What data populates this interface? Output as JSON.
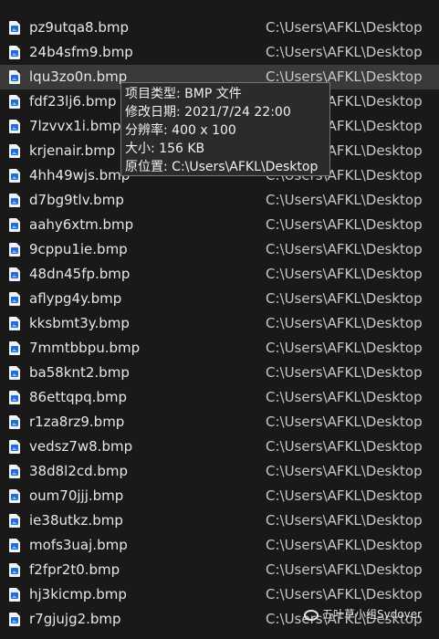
{
  "files": [
    {
      "name": "pz9utqa8.bmp",
      "location": "C:\\Users\\AFKL\\Desktop"
    },
    {
      "name": "24b4sfm9.bmp",
      "location": "C:\\Users\\AFKL\\Desktop"
    },
    {
      "name": "lqu3zo0n.bmp",
      "location": "C:\\Users\\AFKL\\Desktop",
      "selected": true
    },
    {
      "name": "fdf23lj6.bmp",
      "location": "C:\\Users\\AFKL\\Desktop"
    },
    {
      "name": "7lzvvx1i.bmp",
      "location": "C:\\Users\\AFKL\\Desktop"
    },
    {
      "name": "krjenair.bmp",
      "location": "C:\\Users\\AFKL\\Desktop"
    },
    {
      "name": "4hh49wjs.bmp",
      "location": "C:\\Users\\AFKL\\Desktop"
    },
    {
      "name": "d7bg9tlv.bmp",
      "location": "C:\\Users\\AFKL\\Desktop"
    },
    {
      "name": "aahy6xtm.bmp",
      "location": "C:\\Users\\AFKL\\Desktop"
    },
    {
      "name": "9cppu1ie.bmp",
      "location": "C:\\Users\\AFKL\\Desktop"
    },
    {
      "name": "48dn45fp.bmp",
      "location": "C:\\Users\\AFKL\\Desktop"
    },
    {
      "name": "aflypg4y.bmp",
      "location": "C:\\Users\\AFKL\\Desktop"
    },
    {
      "name": "kksbmt3y.bmp",
      "location": "C:\\Users\\AFKL\\Desktop"
    },
    {
      "name": "7mmtbbpu.bmp",
      "location": "C:\\Users\\AFKL\\Desktop"
    },
    {
      "name": "ba58knt2.bmp",
      "location": "C:\\Users\\AFKL\\Desktop"
    },
    {
      "name": "86ettqpq.bmp",
      "location": "C:\\Users\\AFKL\\Desktop"
    },
    {
      "name": "r1za8rz9.bmp",
      "location": "C:\\Users\\AFKL\\Desktop"
    },
    {
      "name": "vedsz7w8.bmp",
      "location": "C:\\Users\\AFKL\\Desktop"
    },
    {
      "name": "38d8l2cd.bmp",
      "location": "C:\\Users\\AFKL\\Desktop"
    },
    {
      "name": "oum70jjj.bmp",
      "location": "C:\\Users\\AFKL\\Desktop"
    },
    {
      "name": "ie38utkz.bmp",
      "location": "C:\\Users\\AFKL\\Desktop"
    },
    {
      "name": "mofs3uaj.bmp",
      "location": "C:\\Users\\AFKL\\Desktop"
    },
    {
      "name": "f2fpr2t0.bmp",
      "location": "C:\\Users\\AFKL\\Desktop"
    },
    {
      "name": "hj3kicmp.bmp",
      "location": "C:\\Users\\AFKL\\Desktop"
    },
    {
      "name": "r7gjujg2.bmp",
      "location": "C:\\Users\\AFKL\\Desktop"
    }
  ],
  "file_icon": "bmp-image-file-icon",
  "tooltip": {
    "type": "项目类型: BMP 文件",
    "modified": "修改日期: 2021/7/24 22:00",
    "resolution": "分辨率: 400 x 100",
    "size": "大小: 156 KB",
    "location": "原位置: C:\\Users\\AFKL\\Desktop"
  },
  "watermark": {
    "text": "五叶草小组Sydoyer",
    "icon": "wechat-icon"
  },
  "colors": {
    "background": "#191919",
    "selected_row": "#3a3a3a",
    "tooltip_bg": "#2b2b2b",
    "tooltip_border": "#767676"
  }
}
